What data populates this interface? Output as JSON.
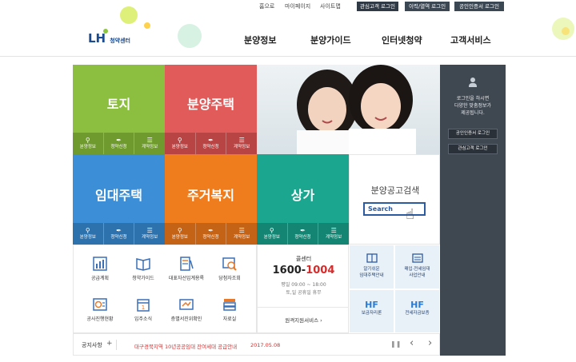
{
  "utility_links": [
    "홈으로",
    "마이페이지",
    "사이트맵"
  ],
  "utility_buttons": [
    "관심고객 로그인",
    "이력/열역 로그인",
    "공인인증서 로그인"
  ],
  "logo": {
    "mark": "LH",
    "text": "청약센터"
  },
  "nav": [
    "분양정보",
    "분양가이드",
    "인터넷청약",
    "고객서비스"
  ],
  "tiles": {
    "land": {
      "title": "토지",
      "color": "#8cbe3f",
      "subs": [
        "분양정보",
        "청약신청",
        "계약정보"
      ]
    },
    "sale": {
      "title": "분양주택",
      "color": "#e25b5b",
      "subs": [
        "분양정보",
        "청약신청",
        "계약정보"
      ]
    },
    "rental": {
      "title": "임대주택",
      "color": "#3c8fd6",
      "subs": [
        "분양정보",
        "청약신청",
        "계약정보"
      ]
    },
    "welfare": {
      "title": "주거복지",
      "color": "#ef7d1e",
      "subs": [
        "분양정보",
        "청약신청",
        "계약정보"
      ]
    },
    "store": {
      "title": "상가",
      "color": "#1aa68f",
      "subs": [
        "분양정보",
        "청약신청",
        "계약정보"
      ]
    }
  },
  "search_box": {
    "title": "분양공고검색",
    "button": "Search"
  },
  "sidebar": {
    "message": [
      "로그인을 하시면",
      "다양한 맞춤정보가",
      "제공됩니다."
    ],
    "buttons": [
      "공인인증서 로그인",
      "관심고객 로그인"
    ]
  },
  "services": [
    "공급계획",
    "청약가이드",
    "대표자선임계용록",
    "당첨자조회",
    "공사진행현황",
    "입주소식",
    "층별서진위확인",
    "자료실"
  ],
  "call_center": {
    "label": "콜센터",
    "number_prefix": "1600-",
    "number_suffix": "1004",
    "hours": "평일 09:00 ~ 18:00",
    "closed": "토,일 공휴일 휴무",
    "remote": "원격지원서비스"
  },
  "quick_cells": [
    {
      "title": "알기쉬운",
      "line2": "임대주택안내"
    },
    {
      "title": "매입·전세임대",
      "line2": "사업안내"
    },
    {
      "title": "보금자리론",
      "mark": "HF"
    },
    {
      "title": "전세자금보증",
      "mark": "HF"
    }
  ],
  "notice": {
    "label": "공지사항",
    "plus": "+",
    "text": "대구경북지역 10년공공임대 잔여세대 공급안내",
    "date": "2017.05.08"
  },
  "colors": {
    "accent_red": "#d62b2b",
    "dark_panel": "#3f4751",
    "search_blue": "#2c5aa0"
  }
}
